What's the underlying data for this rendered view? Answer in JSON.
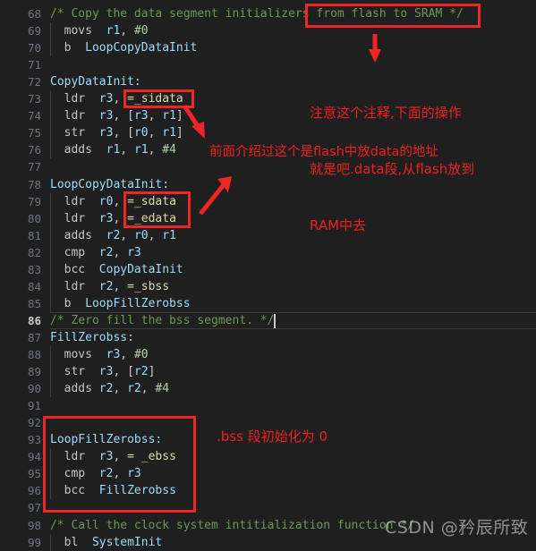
{
  "editor": {
    "theme_bg": "#1f1f1f",
    "gutter_color": "#6e7681",
    "text_color": "#cccccc",
    "comment_color": "#6a9955",
    "active_line": 86,
    "first_line": 68,
    "last_line": 99
  },
  "lines": [
    {
      "n": "68",
      "text": "/* Copy the data segment initializers from flash to SRAM */",
      "indent": 0,
      "type": "comment"
    },
    {
      "n": "69",
      "text": "  movs  r1, #0",
      "indent": 1,
      "type": "code"
    },
    {
      "n": "70",
      "text": "  b  LoopCopyDataInit",
      "indent": 1,
      "type": "code"
    },
    {
      "n": "71",
      "text": "",
      "indent": 0,
      "type": "blank"
    },
    {
      "n": "72",
      "text": "CopyDataInit:",
      "indent": 0,
      "type": "label"
    },
    {
      "n": "73",
      "text": "  ldr  r3, =_sidata",
      "indent": 1,
      "type": "code"
    },
    {
      "n": "74",
      "text": "  ldr  r3, [r3, r1]",
      "indent": 1,
      "type": "code"
    },
    {
      "n": "75",
      "text": "  str  r3, [r0, r1]",
      "indent": 1,
      "type": "code"
    },
    {
      "n": "76",
      "text": "  adds  r1, r1, #4",
      "indent": 1,
      "type": "code"
    },
    {
      "n": "77",
      "text": "",
      "indent": 0,
      "type": "blank"
    },
    {
      "n": "78",
      "text": "LoopCopyDataInit:",
      "indent": 0,
      "type": "label"
    },
    {
      "n": "79",
      "text": "  ldr  r0, =_sdata",
      "indent": 1,
      "type": "code"
    },
    {
      "n": "80",
      "text": "  ldr  r3, =_edata",
      "indent": 1,
      "type": "code"
    },
    {
      "n": "81",
      "text": "  adds  r2, r0, r1",
      "indent": 1,
      "type": "code"
    },
    {
      "n": "82",
      "text": "  cmp  r2, r3",
      "indent": 1,
      "type": "code"
    },
    {
      "n": "83",
      "text": "  bcc  CopyDataInit",
      "indent": 1,
      "type": "code"
    },
    {
      "n": "84",
      "text": "  ldr  r2, =_sbss",
      "indent": 1,
      "type": "code"
    },
    {
      "n": "85",
      "text": "  b  LoopFillZerobss",
      "indent": 1,
      "type": "code"
    },
    {
      "n": "86",
      "text": "/* Zero fill the bss segment. */",
      "indent": 0,
      "type": "comment"
    },
    {
      "n": "87",
      "text": "FillZerobss:",
      "indent": 0,
      "type": "label"
    },
    {
      "n": "88",
      "text": "  movs  r3, #0",
      "indent": 1,
      "type": "code"
    },
    {
      "n": "89",
      "text": "  str  r3, [r2]",
      "indent": 1,
      "type": "code"
    },
    {
      "n": "90",
      "text": "  adds r2, r2, #4",
      "indent": 1,
      "type": "code"
    },
    {
      "n": "91",
      "text": "",
      "indent": 0,
      "type": "blank"
    },
    {
      "n": "92",
      "text": "",
      "indent": 0,
      "type": "blank"
    },
    {
      "n": "93",
      "text": "LoopFillZerobss:",
      "indent": 0,
      "type": "label"
    },
    {
      "n": "94",
      "text": "  ldr  r3, = _ebss",
      "indent": 1,
      "type": "code"
    },
    {
      "n": "95",
      "text": "  cmp  r2, r3",
      "indent": 1,
      "type": "code"
    },
    {
      "n": "96",
      "text": "  bcc  FillZerobss",
      "indent": 1,
      "type": "code"
    },
    {
      "n": "97",
      "text": "",
      "indent": 0,
      "type": "blank"
    },
    {
      "n": "98",
      "text": "/* Call the clock system intitialization function */",
      "indent": 0,
      "type": "comment"
    },
    {
      "n": "99",
      "text": "  bl  SystemInit",
      "indent": 1,
      "type": "code"
    }
  ],
  "annotations": {
    "accent_color": "#f02626",
    "boxes": [
      {
        "name": "box-from-flash-to-sram",
        "label": "from flash to SRAM */"
      },
      {
        "name": "box-sidata",
        "label": "=_sidata"
      },
      {
        "name": "box-sdata-edata",
        "label": "=_sdata / =_edata"
      },
      {
        "name": "box-loopfillzerobss",
        "label": "LoopFillZerobss block"
      }
    ],
    "notes": [
      {
        "name": "note-data-copy",
        "line1": "注意这个注释,下面的操作",
        "line2": "就是吧.data段,从flash放到",
        "line3": "RAM中去"
      },
      {
        "name": "note-flash-data-address",
        "text": "前面介绍过这个是flash中放data的地址"
      },
      {
        "name": "note-bss-init",
        "text": ".bss 段初始化为 0"
      }
    ],
    "arrows": [
      {
        "name": "arrow-down-to-note",
        "direction": "down"
      },
      {
        "name": "arrow-down-right-to-code",
        "direction": "down-right"
      },
      {
        "name": "arrow-up-right-to-code",
        "direction": "up-right"
      }
    ]
  },
  "watermark": {
    "text": "CSDN @矜辰所致"
  }
}
